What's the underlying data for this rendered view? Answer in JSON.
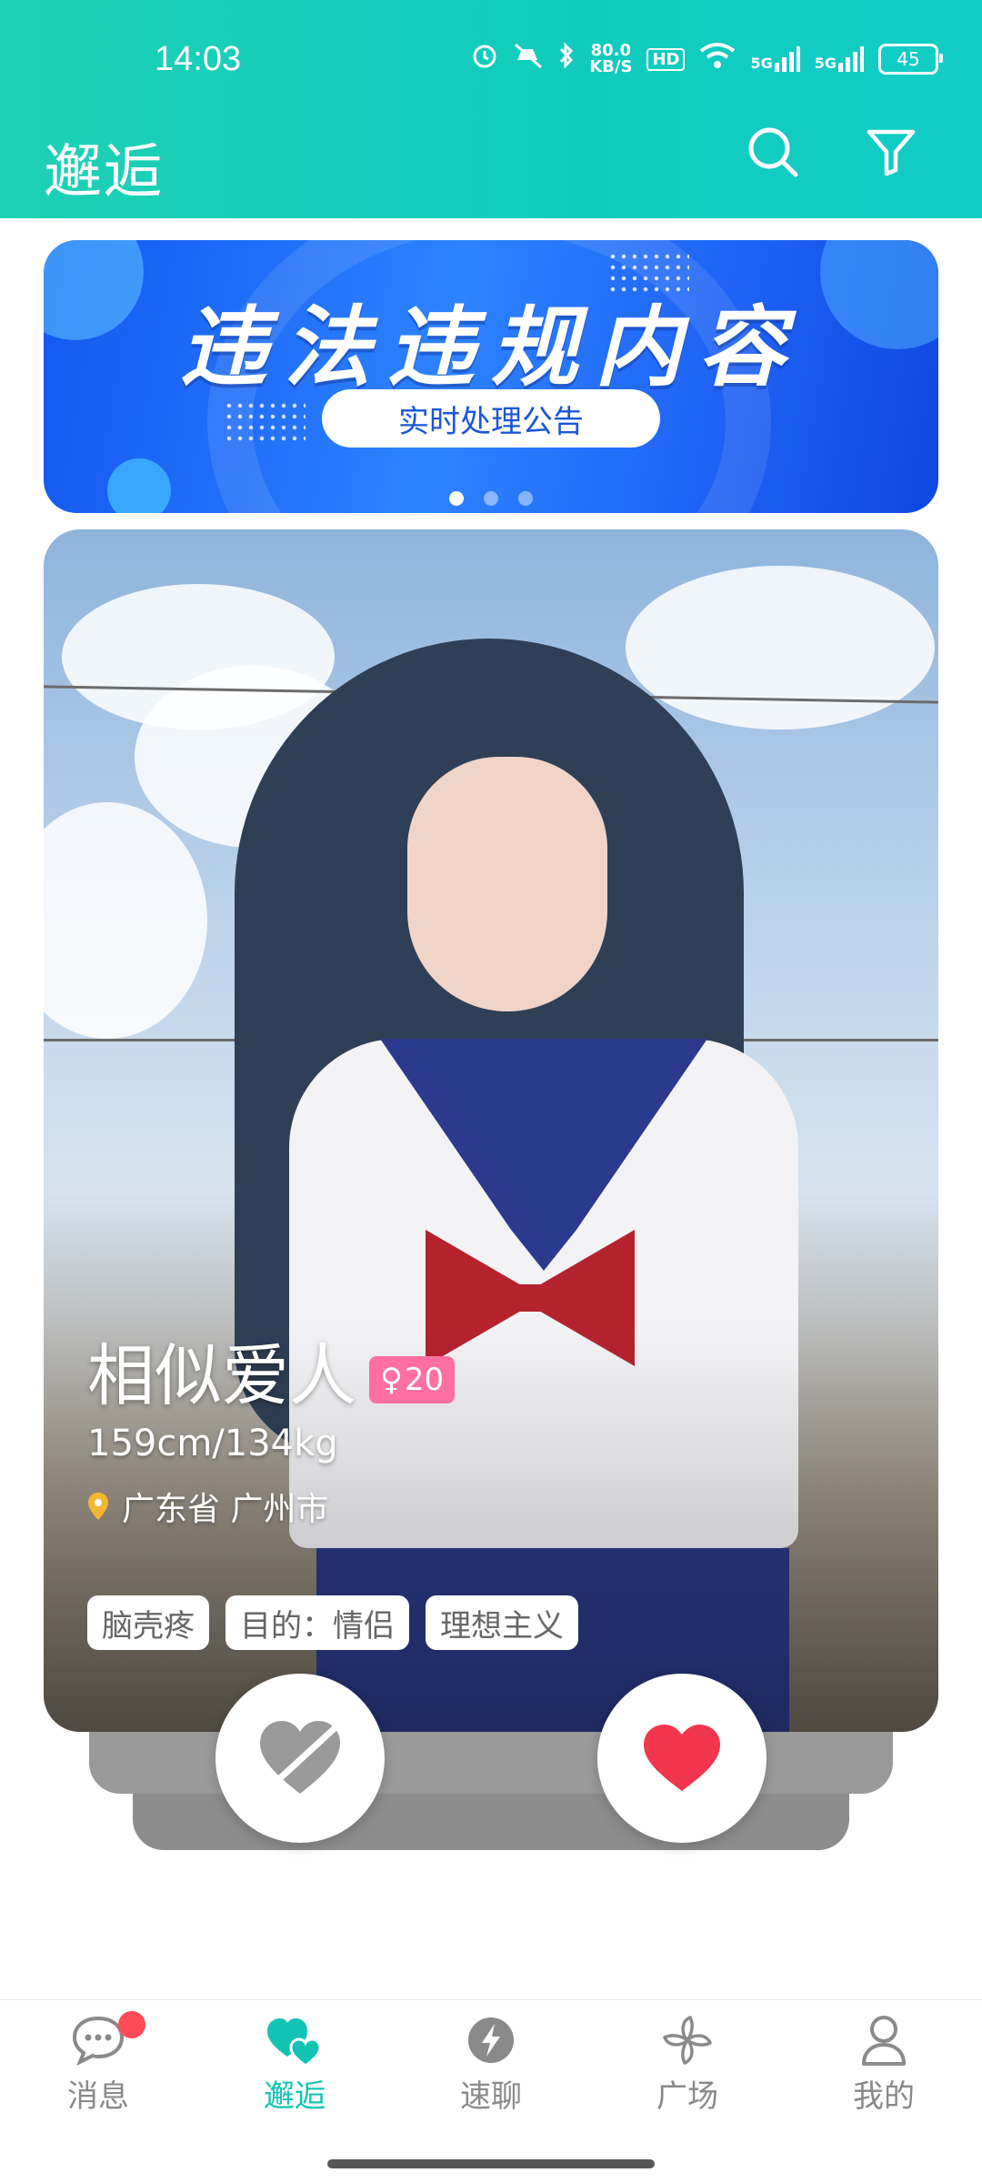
{
  "status_bar": {
    "time": "14:03",
    "net_speed_value": "80.0",
    "net_speed_unit": "KB/S",
    "hd_label": "HD",
    "signal_1": "5G",
    "signal_2": "5G",
    "battery": "45"
  },
  "header": {
    "title": "邂逅",
    "search_icon": "search-icon",
    "filter_icon": "filter-icon"
  },
  "banner": {
    "title": "违法违规内容",
    "subtitle": "实时处理公告",
    "page_count": 3,
    "active_index": 0
  },
  "profile_card": {
    "nickname": "相似爱人",
    "gender_symbol": "♀",
    "age": "20",
    "height_weight": "159cm/134kg",
    "location": "广东省 广州市",
    "tags": [
      "脑壳疼",
      "目的：情侣",
      "理想主义"
    ]
  },
  "actions": {
    "dislike_icon": "broken-heart-icon",
    "like_icon": "heart-icon",
    "like_color": "#f2364e"
  },
  "bottom_nav": {
    "items": [
      {
        "label": "消息",
        "icon": "message-icon",
        "badge": true
      },
      {
        "label": "邂逅",
        "icon": "hearts-icon",
        "active": true
      },
      {
        "label": "速聊",
        "icon": "lightning-icon"
      },
      {
        "label": "广场",
        "icon": "pinwheel-icon"
      },
      {
        "label": "我的",
        "icon": "person-icon"
      }
    ]
  },
  "colors": {
    "accent": "#13c3b4",
    "header_start": "#1ed1b4",
    "badge_pink": "#ff6fa1",
    "notification_red": "#ff4a57"
  }
}
